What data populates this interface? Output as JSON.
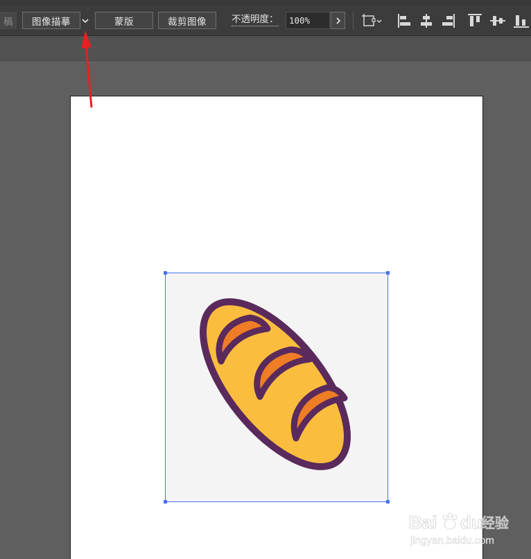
{
  "toolbar": {
    "cut_label": "稿",
    "image_trace_label": "图像描摹",
    "mask_label": "蒙版",
    "crop_label": "裁剪图像",
    "opacity_label": "不透明度：",
    "opacity_value": "100%"
  },
  "icons": {
    "dropdown": "chevron-down-icon",
    "opacity_arrow": "chevron-right-icon",
    "transform": "transform-dropdown-icon",
    "align_left": "align-left-icon",
    "align_hcenter": "align-horizontal-center-icon",
    "align_right": "align-right-icon",
    "align_top": "align-top-icon",
    "align_vcenter": "align-vertical-center-icon",
    "align_bottom": "align-bottom-icon"
  },
  "canvas": {
    "image": "bread-baguette-image",
    "selection_color": "#4a72e8",
    "artboard_color": "#ffffff",
    "bread_colors": {
      "outline": "#5a2a5c",
      "body": "#fbbd3e",
      "scores": "#ef7d26"
    }
  },
  "annotation": {
    "arrow_color": "#e8201f"
  },
  "watermark": {
    "brand": "Bai",
    "brand_suffix": "du",
    "brand_cn": "经验",
    "url": "jingyan.baidu.com"
  }
}
